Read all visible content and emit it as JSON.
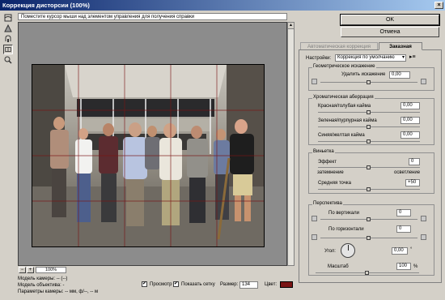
{
  "window": {
    "title": "Коррекция дисторсии (100%)",
    "close_glyph": "×"
  },
  "hint": "Поместите курсор мыши над элементом управления для получения справки",
  "buttons": {
    "ok": "OK",
    "cancel": "Отмена"
  },
  "tools": [
    "distortion-tool",
    "straighten-tool",
    "move-grid-tool",
    "hand-tool",
    "zoom-tool"
  ],
  "zoom": {
    "minus": "−",
    "plus": "+",
    "value": "100%"
  },
  "camera": {
    "model": "Модель камеры: -- (--)",
    "lens": "Модель объектива: -",
    "params": "Параметры камеры: -- мм, ф/--, -- м"
  },
  "options": {
    "preview": "Просмотр",
    "preview_checked": true,
    "grid": "Показать сетку",
    "grid_checked": true,
    "size_label": "Размер:",
    "size_value": "134",
    "color_label": "Цвет:",
    "color_value": "#7a1414"
  },
  "tabs": {
    "auto": "Автоматическая коррекция",
    "custom": "Заказная"
  },
  "settings": {
    "label": "Настройки:",
    "value": "Коррекция по умолчанию"
  },
  "geometric": {
    "title": "Геометрическое искажение",
    "remove_label": "Удалить искажение",
    "remove_value": "0,00",
    "remove_level": 0.5
  },
  "chromatic": {
    "title": "Хроматическая аберрация",
    "items": [
      {
        "label": "Красная/голубая кайма",
        "value": "0,00",
        "level": 0.5
      },
      {
        "label": "Зеленая/пурпурная кайма",
        "value": "0,00",
        "level": 0.5
      },
      {
        "label": "Синяя/желтая кайма",
        "value": "0,00",
        "level": 0.5
      }
    ]
  },
  "vignette": {
    "title": "Виньетка",
    "effect_label": "Эффект",
    "effect_value": "0",
    "effect_level": 0.5,
    "darken": "затемнение",
    "lighten": "осветление",
    "midpoint_label": "Средняя точка",
    "midpoint_value": "+50",
    "midpoint_level": 0.5
  },
  "perspective": {
    "title": "Перспектива",
    "vertical_label": "По вертикали",
    "vertical_value": "0",
    "vertical_level": 0.5,
    "horizontal_label": "По горизонтали",
    "horizontal_value": "0",
    "horizontal_level": 0.5,
    "angle_label": "Угол:",
    "angle_value": "0,00",
    "angle_unit": "°",
    "scale_label": "Масштаб",
    "scale_value": "100",
    "scale_unit": "%",
    "scale_level": 0.5
  }
}
